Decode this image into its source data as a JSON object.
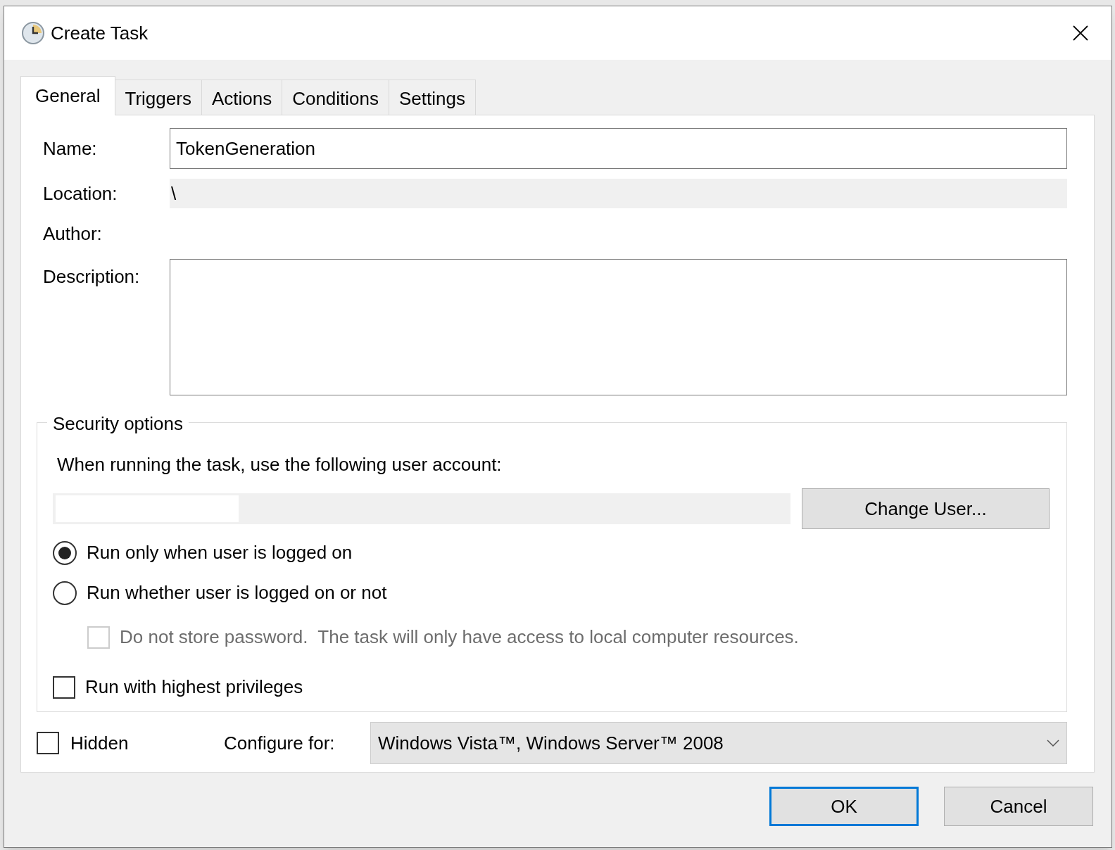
{
  "window": {
    "title": "Create Task"
  },
  "tabs": [
    {
      "label": "General",
      "selected": true
    },
    {
      "label": "Triggers",
      "selected": false
    },
    {
      "label": "Actions",
      "selected": false
    },
    {
      "label": "Conditions",
      "selected": false
    },
    {
      "label": "Settings",
      "selected": false
    }
  ],
  "general": {
    "name": {
      "label": "Name:",
      "value": "TokenGeneration"
    },
    "location": {
      "label": "Location:",
      "value": "\\"
    },
    "author": {
      "label": "Author:"
    },
    "description": {
      "label": "Description:"
    }
  },
  "security_options": {
    "title": "Security options",
    "prompt": "When running the task, use the following user account:",
    "change_user_button": "Change User...",
    "run_modes": [
      {
        "label": "Run only when user is logged on",
        "selected": true
      },
      {
        "label": "Run whether user is logged on or not",
        "selected": false
      }
    ],
    "do_not_store_password": {
      "label": "Do not store password.  The task will only have access to local computer resources.",
      "checked": false,
      "disabled": true
    },
    "highest_privileges": {
      "label": "Run with highest privileges",
      "checked": false
    }
  },
  "hidden": {
    "label": "Hidden",
    "checked": false
  },
  "configure_for": {
    "label": "Configure for:",
    "value": "Windows Vista™, Windows Server™ 2008"
  },
  "buttons": [
    {
      "label": "OK",
      "default": true
    },
    {
      "label": "Cancel",
      "default": false
    }
  ]
}
